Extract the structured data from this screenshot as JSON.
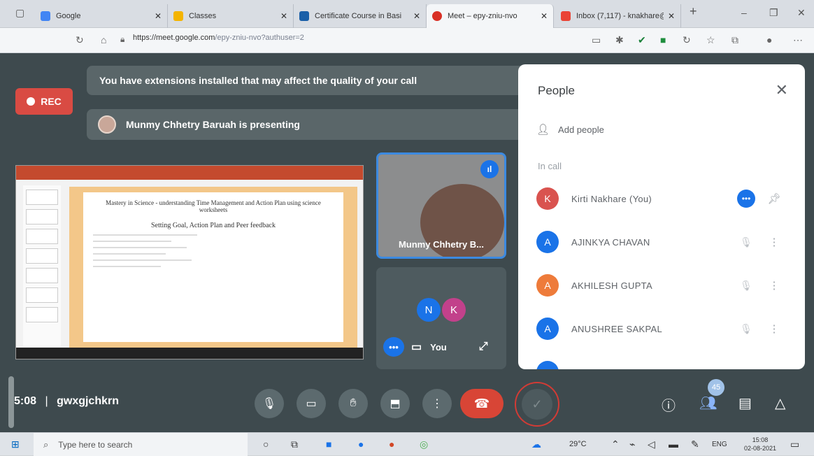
{
  "browser": {
    "tabs": [
      {
        "title": "Google",
        "fav_color": "#4285f4"
      },
      {
        "title": "Classes",
        "fav_color": "#f4b400"
      },
      {
        "title": "Certificate Course in Basi",
        "fav_color": "#1a5fa8"
      },
      {
        "title": "Meet – epy-zniu-nvo",
        "fav_color": "#d93025"
      },
      {
        "title": "Inbox (7,117) - knakhare@",
        "fav_color": "#ea4335"
      }
    ],
    "new_tab": "+",
    "url_host": "https://meet.google.com",
    "url_path": "/epy-zniu-nvo?authuser=2"
  },
  "meet": {
    "rec_label": "REC",
    "extensions_banner": "You have extensions installed that may affect the quality of your call",
    "presenting_banner": "Munmy Chhetry Baruah is presenting",
    "slide": {
      "title": "Mastery in Science - understanding Time Management and Action Plan using science worksheets",
      "subtitle": "Setting Goal, Action Plan and Peer feedback"
    },
    "presenter_tile_name": "Munmy Chhetry B...",
    "self_tile": {
      "avatar1": "N",
      "avatar2": "K",
      "label": "You"
    },
    "meeting_time": "5:08",
    "meeting_code": "gwxgjchkrn",
    "participants_count": "45"
  },
  "people_panel": {
    "title": "People",
    "add_people": "Add people",
    "in_call": "In call",
    "participants": [
      {
        "initial": "K",
        "name": "Kirti Nakhare (You)",
        "color": "#d9534f"
      },
      {
        "initial": "A",
        "name": "AJINKYA CHAVAN",
        "color": "#1a73e8"
      },
      {
        "initial": "A",
        "name": "AKHILESH GUPTA",
        "color": "#ee7b3a"
      },
      {
        "initial": "A",
        "name": "ANUSHREE SAKPAL",
        "color": "#1a73e8"
      }
    ]
  },
  "taskbar": {
    "search_placeholder": "Type here to search",
    "temperature": "29°C",
    "language": "ENG",
    "time": "15:08",
    "date": "02-08-2021"
  }
}
